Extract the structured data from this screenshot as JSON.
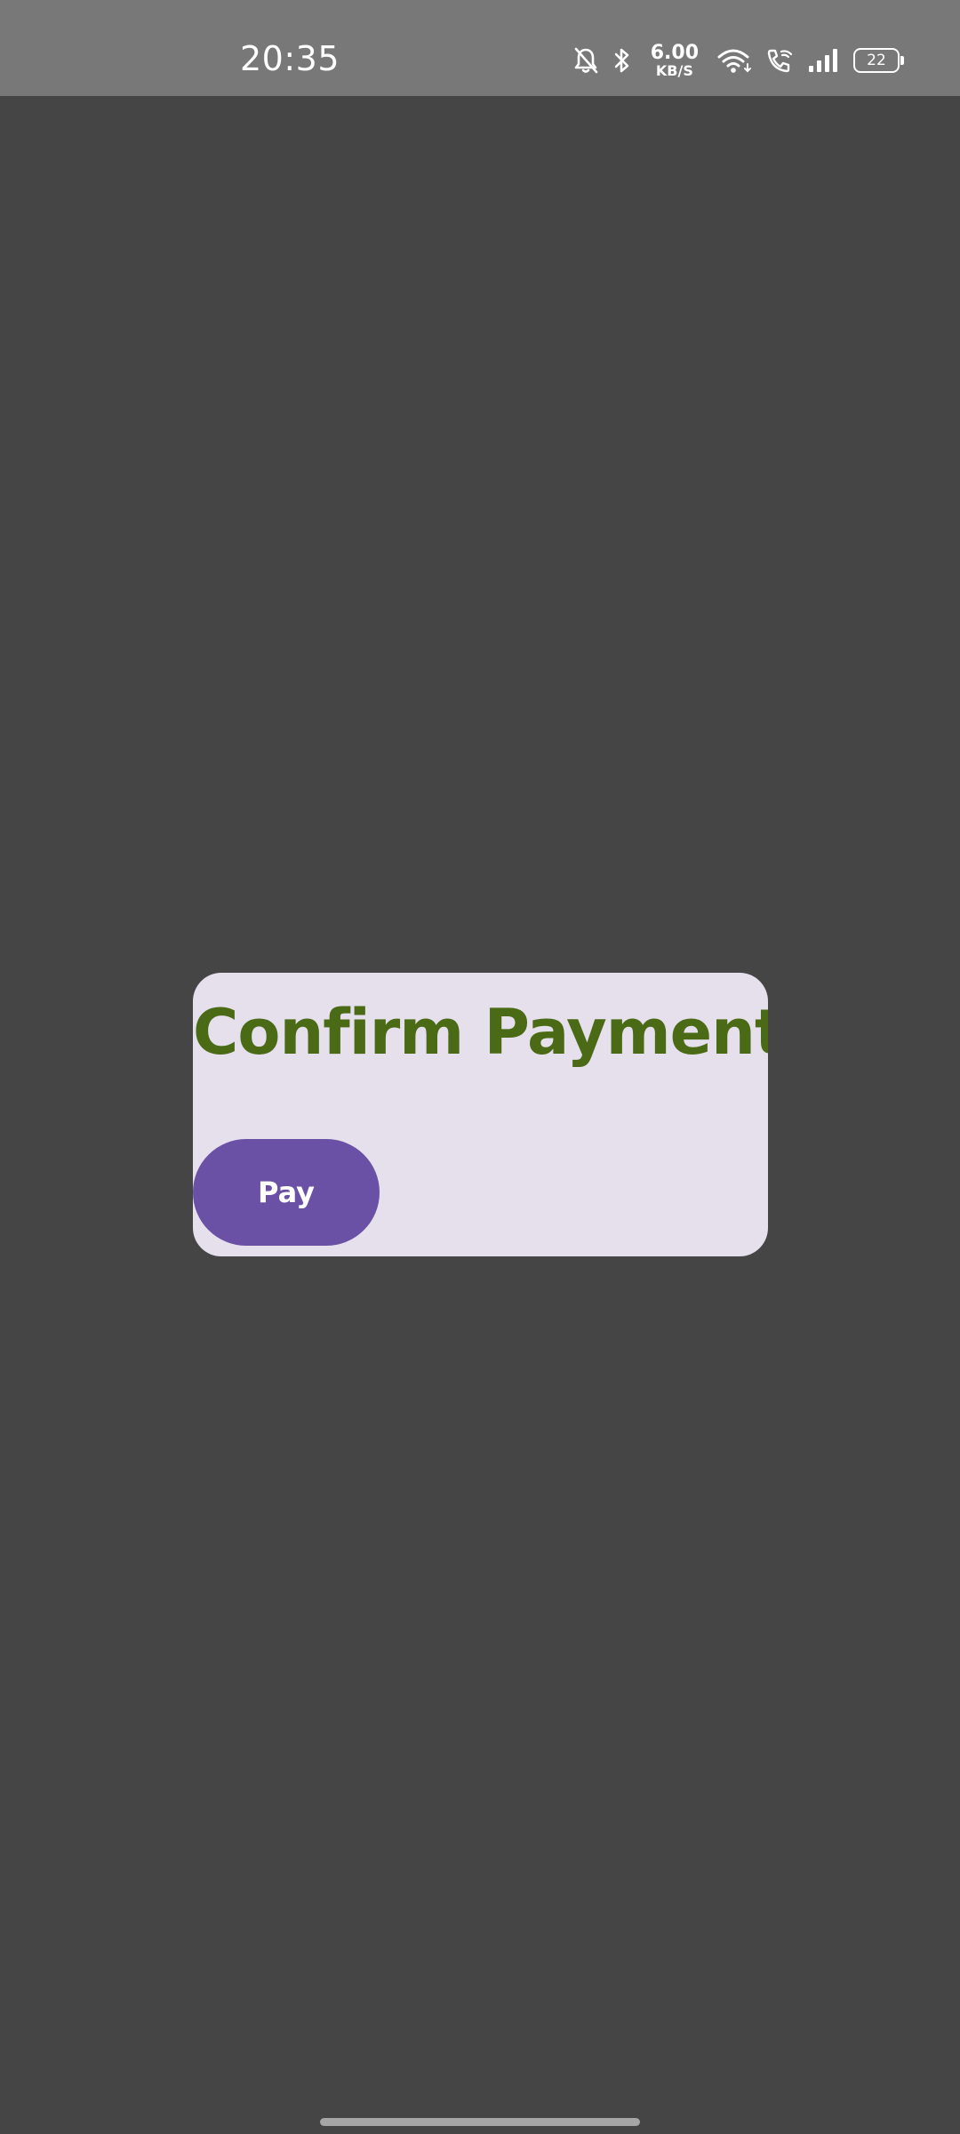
{
  "status_bar": {
    "time": "20:35",
    "net_speed_value": "6.00",
    "net_speed_unit": "KB/S",
    "battery_level": "22",
    "icons": [
      "bell-off-icon",
      "bluetooth-icon",
      "wifi-icon",
      "wifi-calling-icon",
      "cell-signal-icon",
      "battery-icon"
    ]
  },
  "dialog": {
    "title": "Confirm Payment",
    "pay_button_label": "Pay"
  },
  "colors": {
    "scrim": "#454545",
    "status_bar": "#787878",
    "dialog_background": "#e6dfec",
    "title_text": "#4a6a16",
    "button_background": "#6a51a6",
    "button_text": "#ffffff"
  }
}
